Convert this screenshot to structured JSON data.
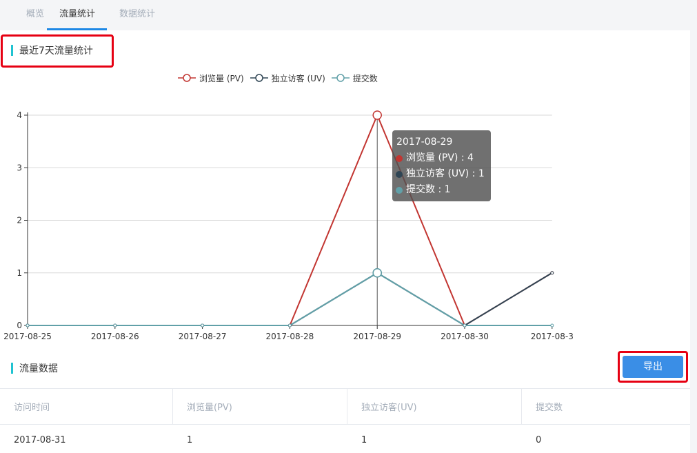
{
  "tabs": [
    {
      "label": "概览"
    },
    {
      "label": "流量统计"
    },
    {
      "label": "数据统计"
    }
  ],
  "traffic_section": {
    "title": "最近7天流量统计"
  },
  "data_section": {
    "title": "流量数据"
  },
  "export_label": "导出",
  "colors": {
    "pv": "#c23531",
    "uv": "#2f4554",
    "submit": "#61a0a8",
    "accent": "#1e88e5",
    "section_bar": "#20c3d1",
    "highlight": "#e60012"
  },
  "chart_data": {
    "type": "line",
    "x": [
      "2017-08-25",
      "2017-08-26",
      "2017-08-27",
      "2017-08-28",
      "2017-08-29",
      "2017-08-30",
      "2017-08-31"
    ],
    "x_tick_labels": [
      "2017-08-25",
      "2017-08-26",
      "2017-08-27",
      "2017-08-28",
      "2017-08-29",
      "2017-08-30",
      "2017-08-3"
    ],
    "series": [
      {
        "name": "浏览量 (PV)",
        "values": [
          0,
          0,
          0,
          0,
          4,
          0,
          1
        ]
      },
      {
        "name": "独立访客 (UV)",
        "values": [
          0,
          0,
          0,
          0,
          1,
          0,
          1
        ]
      },
      {
        "name": "提交数",
        "values": [
          0,
          0,
          0,
          0,
          1,
          0,
          0
        ]
      }
    ],
    "ylim": [
      0,
      4
    ],
    "yticks": [
      0,
      1,
      2,
      3,
      4
    ],
    "grid": true,
    "legend": "top-center"
  },
  "tooltip": {
    "date": "2017-08-29",
    "rows": [
      {
        "label": "浏览量 (PV) : 4"
      },
      {
        "label": "独立访客 (UV) : 1"
      },
      {
        "label": "提交数 : 1"
      }
    ]
  },
  "table": {
    "headers": [
      "访问时间",
      "浏览量(PV)",
      "独立访客(UV)",
      "提交数"
    ],
    "rows": [
      [
        "2017-08-31",
        "1",
        "1",
        "0"
      ]
    ]
  }
}
